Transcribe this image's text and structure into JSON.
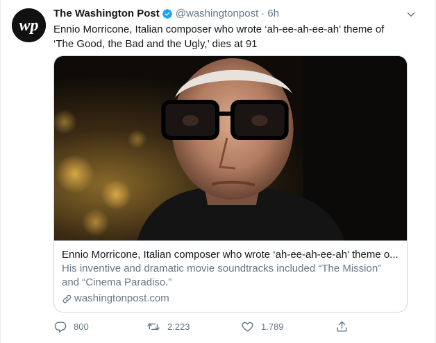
{
  "author": {
    "name": "The Washington Post",
    "handle": "@washingtonpost",
    "separator": "·",
    "time": "6h",
    "avatar_icon": "washington-post-logo-icon",
    "verified_icon": "verified-badge-icon"
  },
  "tweet": {
    "text": "Ennio Morricone, Italian composer who wrote ‘ah-ee-ah-ee-ah’ theme of ‘The Good, the Bad and the Ugly,’ dies at 91"
  },
  "card": {
    "title": "Ennio Morricone, Italian composer who wrote ‘ah-ee-ah-ee-ah’ theme o...",
    "description": "His inventive and dramatic movie soundtracks included “The Mission” and “Cinema Paradiso.”",
    "domain": "washingtonpost.com",
    "link_icon": "link-icon",
    "image": "portrait-photo"
  },
  "actions": {
    "reply_count": "800",
    "retweet_count": "2.223",
    "like_count": "1.789",
    "share_icon": "share-icon"
  },
  "colors": {
    "text_primary": "#14171a",
    "text_secondary": "#657786",
    "verified_blue": "#1da1f2",
    "border": "#ccd6dd"
  }
}
